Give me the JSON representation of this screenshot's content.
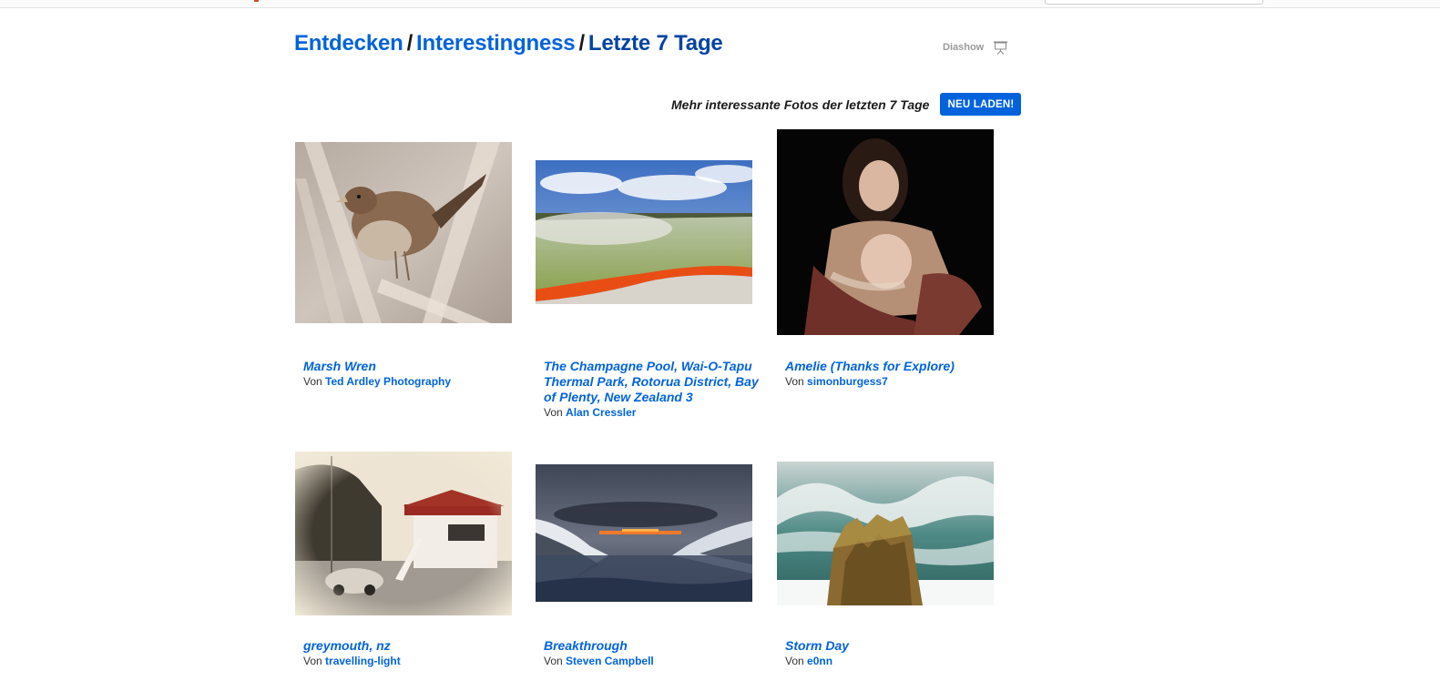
{
  "breadcrumb": {
    "explore": "Entdecken",
    "interestingness": "Interestingness",
    "period": "Letzte 7 Tage",
    "separator": "/"
  },
  "slideshow": {
    "label": "Diashow",
    "icon": "slideshow-icon"
  },
  "reload": {
    "text": "Mehr interessante Fotos der letzten 7 Tage",
    "button_label": "NEU LADEN!"
  },
  "by_prefix": "Von",
  "photos": [
    {
      "title": "Marsh Wren",
      "author": "Ted Ardley Photography"
    },
    {
      "title": "The Champagne Pool, Wai-O-Tapu Thermal Park, Rotorua District, Bay of Plenty, New Zealand 3",
      "author": "Alan Cressler"
    },
    {
      "title": "Amelie (Thanks for Explore)",
      "author": "simonburgess7"
    },
    {
      "title": "greymouth, nz",
      "author": "travelling-light"
    },
    {
      "title": "Breakthrough",
      "author": "Steven Campbell"
    },
    {
      "title": "Storm Day",
      "author": "e0nn"
    }
  ],
  "colors": {
    "link": "#0063dc",
    "button_bg": "#0063dc"
  }
}
